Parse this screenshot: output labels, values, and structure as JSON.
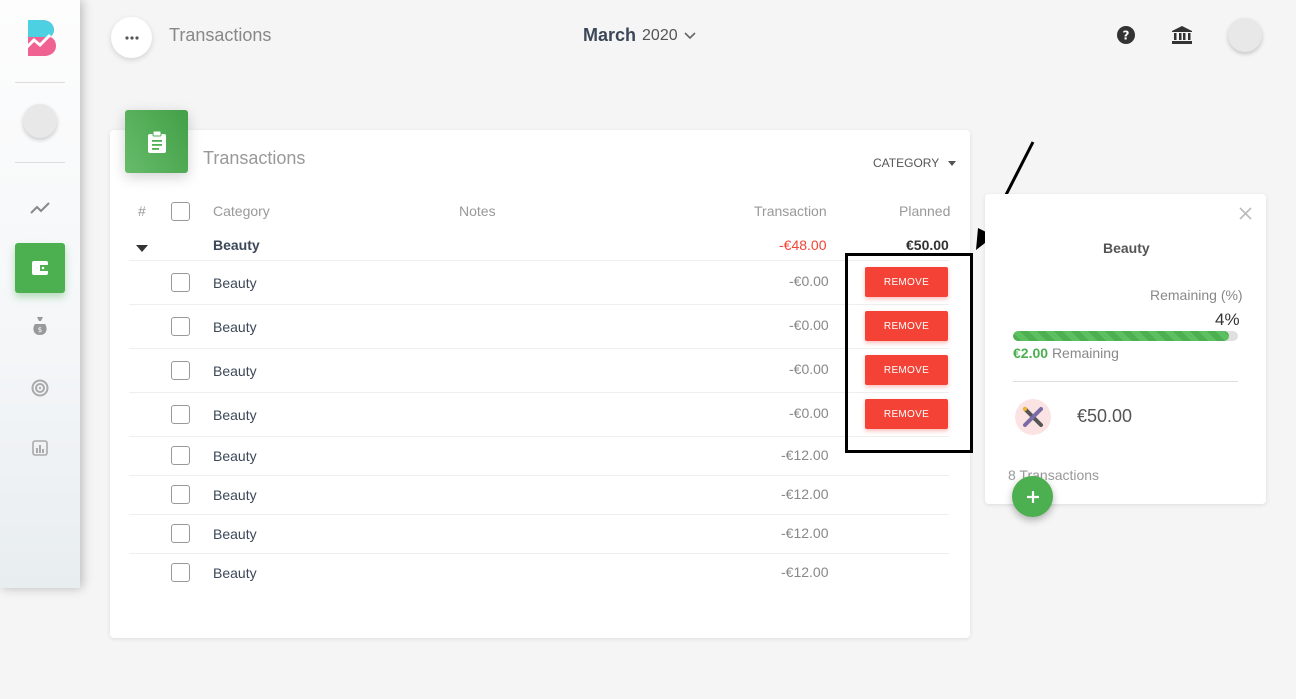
{
  "header": {
    "title": "Transactions",
    "month": "March",
    "year": "2020"
  },
  "card": {
    "title": "Transactions",
    "dropdown_label": "CATEGORY"
  },
  "table": {
    "columns": {
      "index": "#",
      "category": "Category",
      "notes": "Notes",
      "transaction": "Transaction",
      "planned": "Planned"
    },
    "group": {
      "category": "Beauty",
      "transaction": "-€48.00",
      "planned": "€50.00"
    },
    "rows": [
      {
        "category": "Beauty",
        "transaction": "-€0.00",
        "action": "REMOVE"
      },
      {
        "category": "Beauty",
        "transaction": "-€0.00",
        "action": "REMOVE"
      },
      {
        "category": "Beauty",
        "transaction": "-€0.00",
        "action": "REMOVE"
      },
      {
        "category": "Beauty",
        "transaction": "-€0.00",
        "action": "REMOVE"
      },
      {
        "category": "Beauty",
        "transaction": "-€12.00"
      },
      {
        "category": "Beauty",
        "transaction": "-€12.00"
      },
      {
        "category": "Beauty",
        "transaction": "-€12.00"
      },
      {
        "category": "Beauty",
        "transaction": "-€12.00"
      }
    ]
  },
  "detail": {
    "title": "Beauty",
    "remaining_label": "Remaining (%)",
    "remaining_percent": "4%",
    "progress_fraction": 0.96,
    "remaining_amount": "€2.00",
    "remaining_text": "Remaining",
    "planned_amount": "€50.00",
    "transactions_count": "8 Transactions"
  },
  "colors": {
    "accent": "#4caf50",
    "danger": "#f44336",
    "negative_text": "#f44336"
  }
}
